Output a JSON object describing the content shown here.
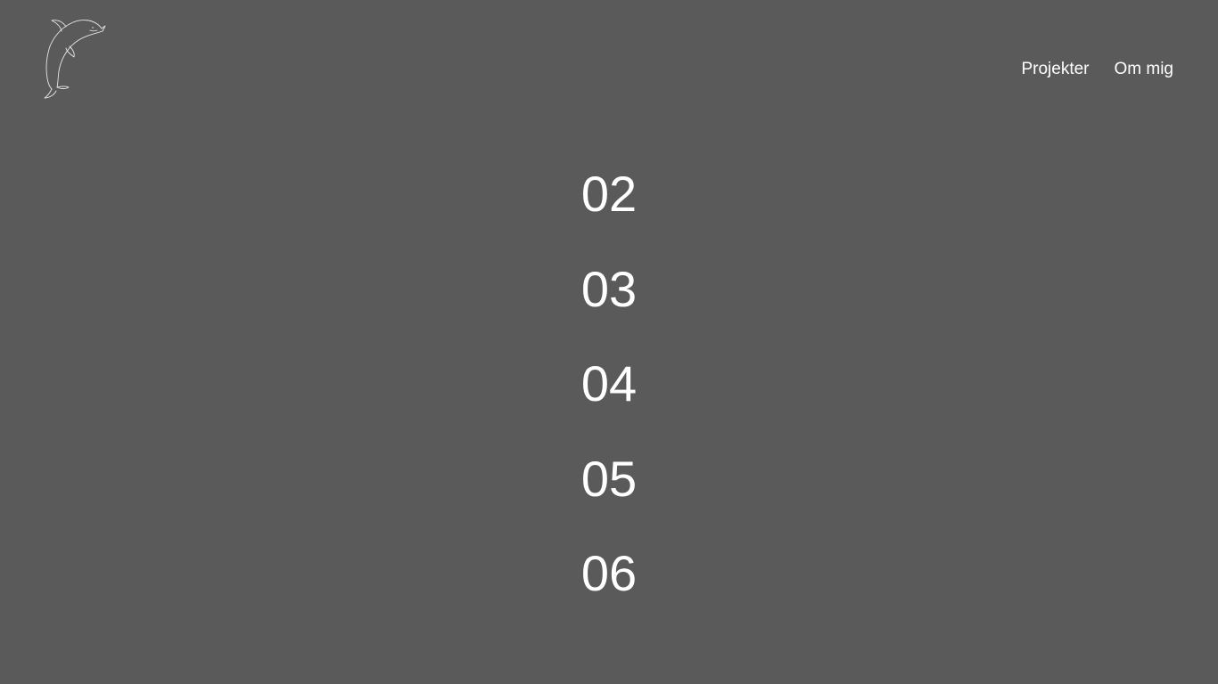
{
  "logo": {
    "icon": "dolphin-icon",
    "color": "#e6e6e6"
  },
  "nav": {
    "items": [
      {
        "label": "Projekter"
      },
      {
        "label": "Om mig"
      }
    ]
  },
  "projects": {
    "numbers": [
      "02",
      "03",
      "04",
      "05",
      "06"
    ]
  },
  "colors": {
    "background": "#5a5a5a",
    "text": "#ffffff"
  }
}
